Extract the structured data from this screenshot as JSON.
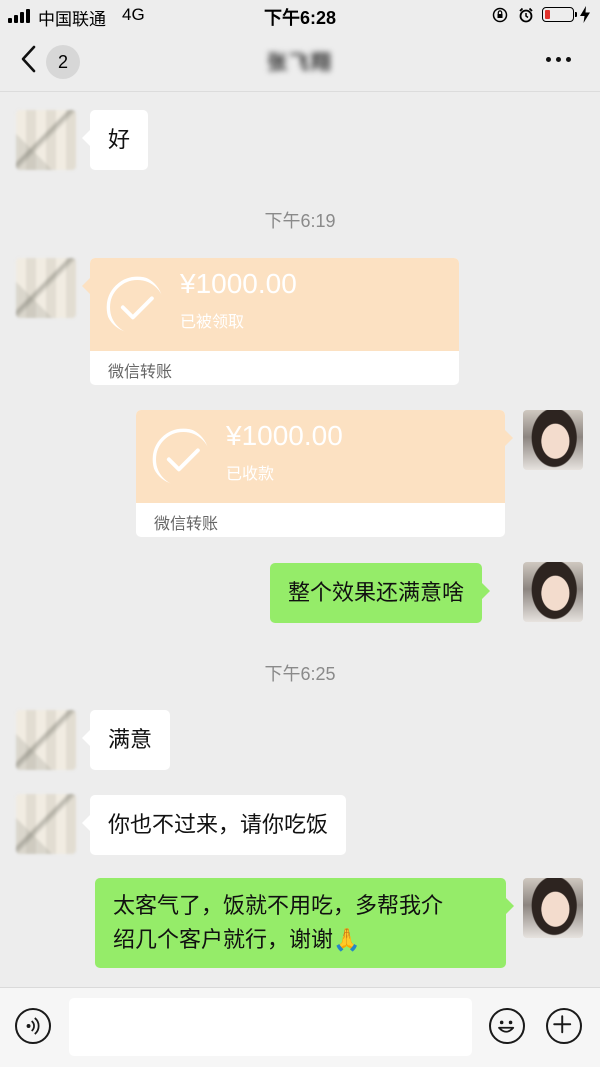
{
  "status_bar": {
    "carrier": "中国联通",
    "network": "4G",
    "time": "下午6:28",
    "battery_level": 0.2,
    "battery_color": "#e0322c"
  },
  "header": {
    "unread_count": "2",
    "contact_name": "张飞翔",
    "back_icon": "chevron-left-icon",
    "more_icon": "more-dots-icon"
  },
  "messages": {
    "m1": "好",
    "t1": "下午6:19",
    "transfer1": {
      "amount": "¥1000.00",
      "status": "已被领取",
      "label": "微信转账"
    },
    "transfer2": {
      "amount": "¥1000.00",
      "status": "已收款",
      "label": "微信转账"
    },
    "m2": "整个效果还满意啥",
    "t2": "下午6:25",
    "m3": "满意",
    "m4": "你也不过来，请你吃饭",
    "m5_line1": "太客气了，饭就不用吃，多帮我介",
    "m5_line2": "绍几个客户就行，谢谢🙏"
  },
  "colors": {
    "background": "#ededed",
    "green_bubble": "#95ec69",
    "transfer_bg": "#fce1c2"
  },
  "input_bar": {
    "voice_icon": "voice-icon",
    "emoji_icon": "emoji-icon",
    "plus_icon": "plus-icon",
    "value": ""
  }
}
